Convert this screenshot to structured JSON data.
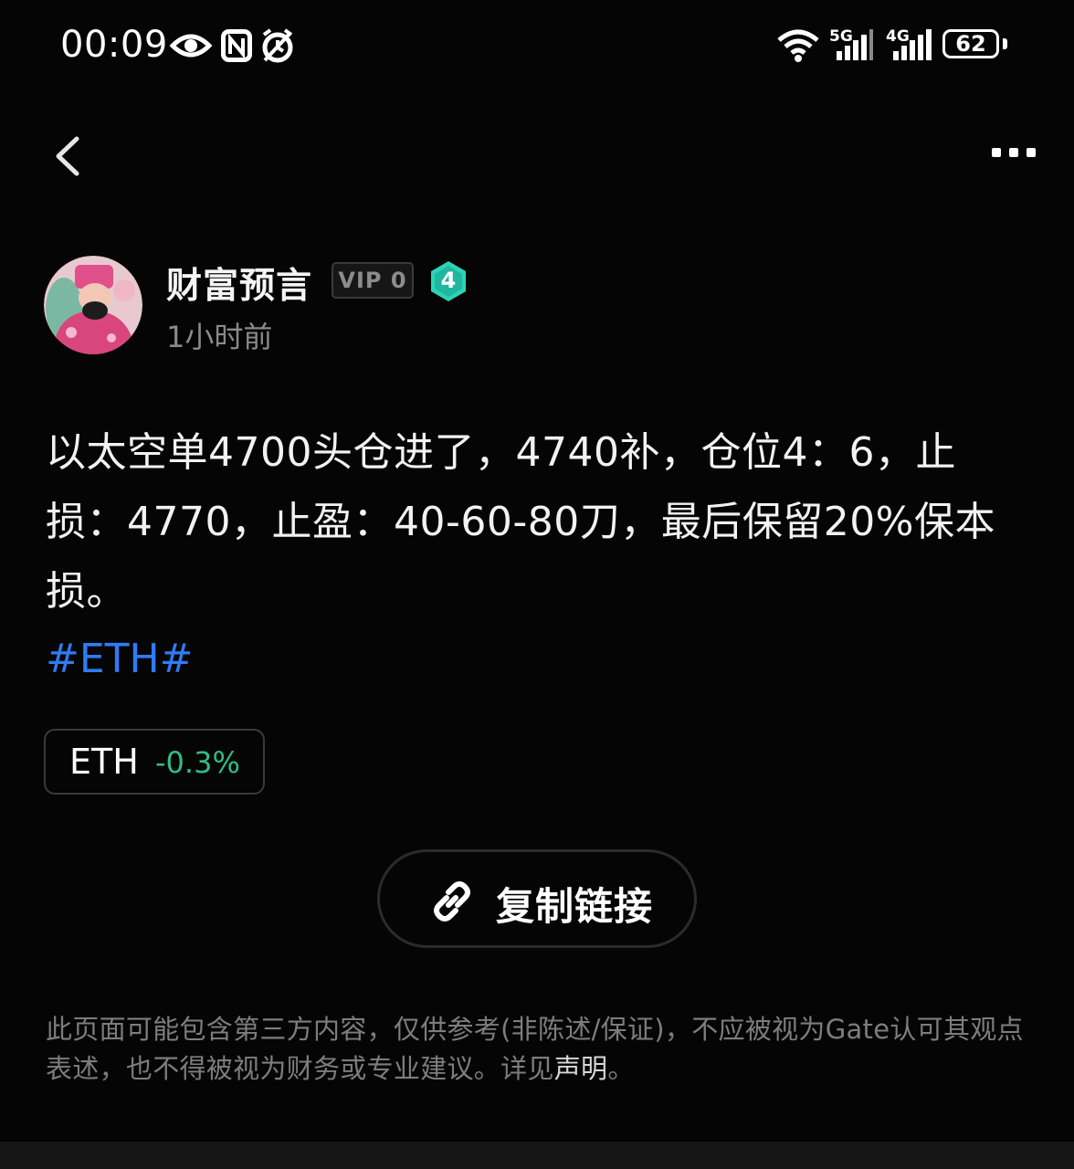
{
  "status_bar": {
    "time": "00:09",
    "icons": [
      "eye-icon",
      "nfc-icon",
      "alarm-icon",
      "wifi-icon",
      "signal-5g-icon",
      "signal-4g-icon"
    ],
    "net1": "5G",
    "net2": "4G",
    "battery": "62"
  },
  "nav": {
    "back_icon": "chevron-left-icon",
    "more_icon": "more-dots-icon"
  },
  "author": {
    "name": "财富预言",
    "vip": "VIP 0",
    "level": "4",
    "time": "1小时前",
    "level_color": "#2ed3b7"
  },
  "post": {
    "content": "以太空单4700头仓进了，4740补，仓位4：6，止损：4770，止盈：40-60-80刀，最后保留20%保本损。",
    "hashtag": "#ETH#"
  },
  "ticker": {
    "symbol": "ETH",
    "change": "-0.3%",
    "change_color": "#2ebd85"
  },
  "copy_link": {
    "label": "复制链接",
    "icon": "link-icon"
  },
  "disclaimer": {
    "text": "此页面可能包含第三方内容，仅供参考(非陈述/保证)，不应被视为Gate认可其观点表述，也不得被视为财务或专业建议。详见",
    "link_text": "声明",
    "end": "。"
  },
  "colors": {
    "background": "#050505",
    "hashtag": "#2f7bf5",
    "muted": "#7d7d7d"
  }
}
